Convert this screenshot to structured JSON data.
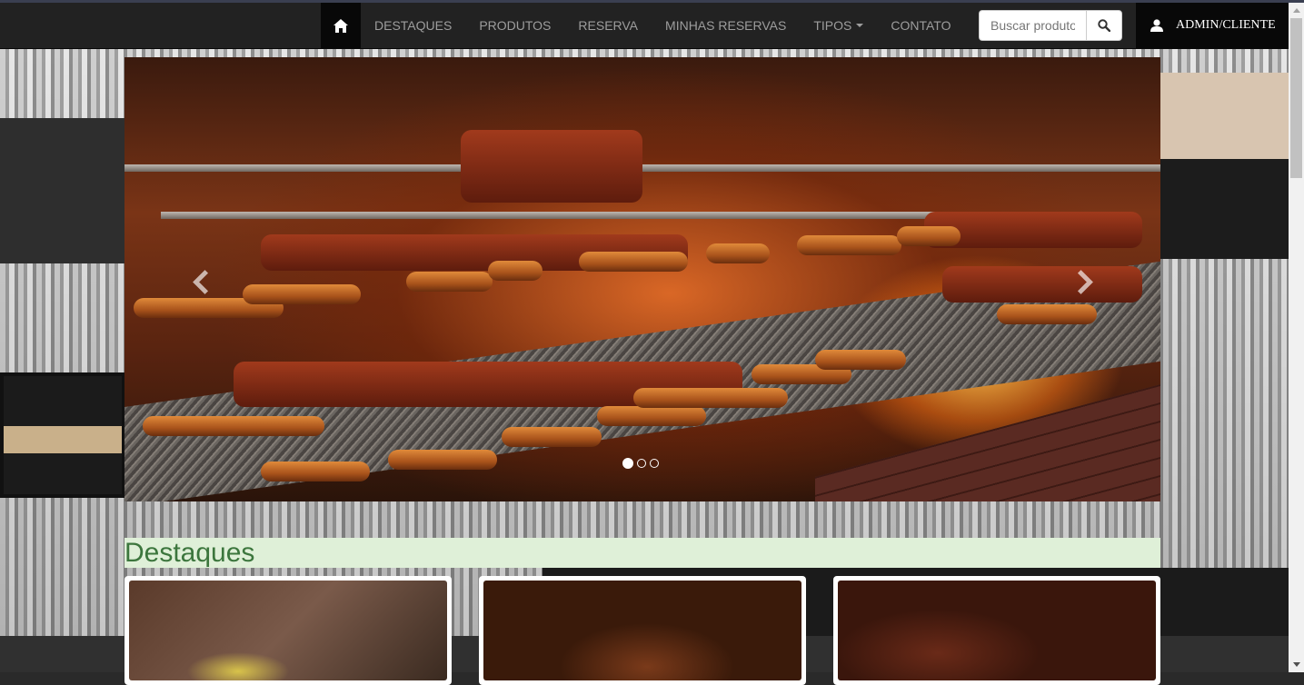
{
  "navbar": {
    "home_icon": "home-icon",
    "links": [
      {
        "label": "DESTAQUES"
      },
      {
        "label": "PRODUTOS"
      },
      {
        "label": "RESERVA"
      },
      {
        "label": "MINHAS RESERVAS"
      },
      {
        "label": "TIPOS",
        "dropdown": true
      },
      {
        "label": "CONTATO"
      }
    ],
    "search": {
      "placeholder": "Buscar produto",
      "value": "",
      "button_icon": "search-icon"
    },
    "user": {
      "icon": "user-icon",
      "label": "ADMIN/CLIENTE"
    }
  },
  "carousel": {
    "slides": 3,
    "active_slide": 1,
    "prev_icon": "chevron-left-icon",
    "next_icon": "chevron-right-icon"
  },
  "section": {
    "title": "Destaques"
  },
  "cards": [
    {
      "image": "food-photo-1"
    },
    {
      "image": "food-photo-2"
    },
    {
      "image": "food-photo-3"
    }
  ],
  "colors": {
    "navbar_bg": "#222222",
    "navbar_active_bg": "#080808",
    "nav_link": "#9d9d9d",
    "section_bg": "#dff0d8",
    "section_text": "#3c763d"
  }
}
